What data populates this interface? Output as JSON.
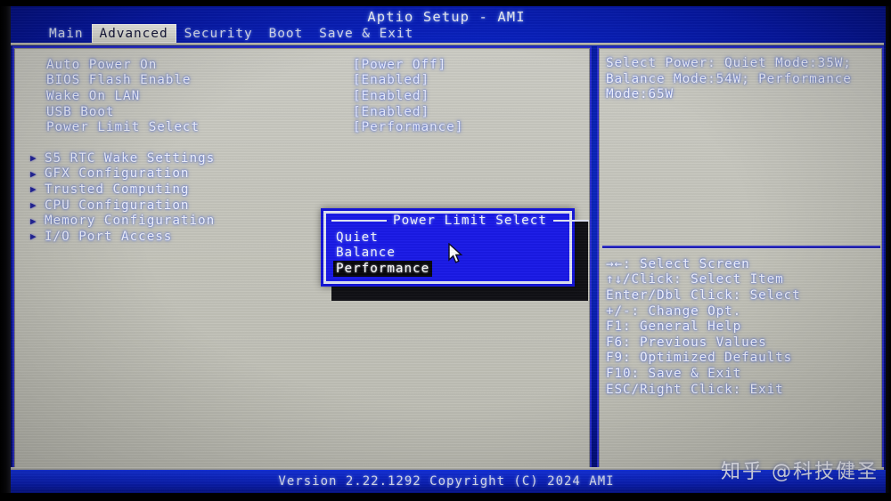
{
  "window": {
    "title": "Aptio Setup - AMI"
  },
  "tabs": [
    {
      "label": "Main",
      "active": false
    },
    {
      "label": "Advanced",
      "active": true
    },
    {
      "label": "Security",
      "active": false
    },
    {
      "label": "Boot",
      "active": false
    },
    {
      "label": "Save & Exit",
      "active": false
    }
  ],
  "settings": [
    {
      "label": "Auto Power On",
      "value": "[Power Off]"
    },
    {
      "label": "BIOS Flash Enable",
      "value": "[Enabled]"
    },
    {
      "label": "Wake On LAN",
      "value": "[Enabled]"
    },
    {
      "label": "USB Boot",
      "value": "[Enabled]"
    },
    {
      "label": "Power Limit Select",
      "value": "[Performance]"
    }
  ],
  "submenus": [
    {
      "label": "S5 RTC Wake Settings",
      "arrow_icon": "triangle-right-icon"
    },
    {
      "label": "GFX Configuration",
      "arrow_icon": "triangle-right-icon"
    },
    {
      "label": "Trusted Computing",
      "arrow_icon": "triangle-right-icon"
    },
    {
      "label": "CPU Configuration",
      "arrow_icon": "triangle-right-icon"
    },
    {
      "label": "Memory Configuration",
      "arrow_icon": "triangle-right-icon"
    },
    {
      "label": "I/O Port Access",
      "arrow_icon": "triangle-right-icon"
    }
  ],
  "help": {
    "text": "Select Power: Quiet Mode:35W; Balance Mode:54W; Performance Mode:65W"
  },
  "key_legend": [
    {
      "label": "→←: Select Screen"
    },
    {
      "label": "↑↓/Click: Select Item"
    },
    {
      "label": "Enter/Dbl Click: Select"
    },
    {
      "label": "+/-: Change Opt."
    },
    {
      "label": "F1: General Help"
    },
    {
      "label": "F6: Previous Values"
    },
    {
      "label": "F9: Optimized Defaults"
    },
    {
      "label": "F10: Save & Exit"
    },
    {
      "label": "ESC/Right Click: Exit"
    }
  ],
  "popup": {
    "title": "Power Limit Select",
    "options": [
      {
        "label": "Quiet",
        "selected": false
      },
      {
        "label": "Balance",
        "selected": false
      },
      {
        "label": "Performance",
        "selected": true
      }
    ]
  },
  "footer": {
    "version_text": "Version 2.22.1292 Copyright (C) 2024 AMI"
  },
  "watermark": {
    "text": "知乎 @科技健圣"
  },
  "cursor": {
    "icon": "mouse-pointer-icon"
  },
  "colors": {
    "screen_blue": "#0a24c8",
    "panel_gray": "#c6c6bd",
    "panel_border_blue": "#2b2fd0",
    "popup_blue": "#1a1ae8",
    "selected_bg": "#07070b",
    "text_white": "#f2f4ff",
    "active_tab_bg": "#e2e2da"
  }
}
